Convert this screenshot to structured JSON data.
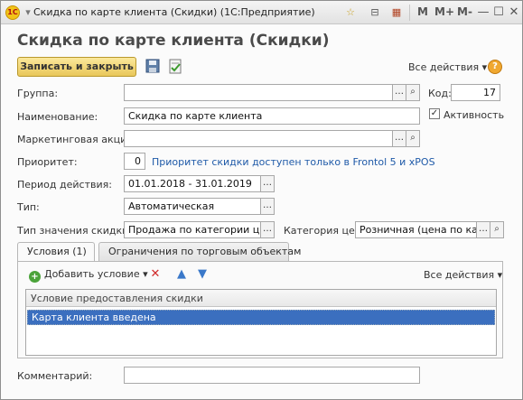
{
  "window": {
    "logo_text": "1С",
    "title": "Скидка по карте клиента (Скидки)  (1С:Предприятие)",
    "m_buttons": [
      "M",
      "M+",
      "M-"
    ],
    "controls": {
      "minimize": "—",
      "maximize": "☐",
      "close": "✕"
    },
    "accent_color": "#e9c75a"
  },
  "form": {
    "title": "Скидка по карте клиента (Скидки)",
    "save_close_label": "Записать и закрыть",
    "all_actions_label": "Все действия",
    "help_label": "?"
  },
  "fields": {
    "group": {
      "label": "Группа:",
      "value": ""
    },
    "code": {
      "label": "Код:",
      "value": "17"
    },
    "name": {
      "label": "Наименование:",
      "value": "Скидка по карте клиента"
    },
    "active": {
      "label": "Активность",
      "checked": true
    },
    "campaign": {
      "label": "Маркетинговая акция:",
      "value": ""
    },
    "priority": {
      "label": "Приоритет:",
      "value": "0",
      "hint": "Приоритет скидки доступен только в Frontol 5 и xPOS"
    },
    "period": {
      "label": "Период действия:",
      "value": "01.01.2018 - 31.01.2019"
    },
    "type": {
      "label": "Тип:",
      "value": "Автоматическая"
    },
    "value_type": {
      "label": "Тип значения скидки:",
      "value": "Продажа по категории цен"
    },
    "price_category": {
      "label": "Категория цен:",
      "value": "Розничная (цена по карте"
    },
    "comment": {
      "label": "Комментарий:",
      "value": ""
    }
  },
  "tabs": [
    {
      "label": "Условия (1)",
      "active": true
    },
    {
      "label": "Ограничения по торговым объектам",
      "active": false
    }
  ],
  "conditions": {
    "add_label": "Добавить условие",
    "all_actions_label": "Все действия",
    "column_header": "Условие предоставления скидки",
    "rows": [
      "Карта клиента введена"
    ]
  }
}
